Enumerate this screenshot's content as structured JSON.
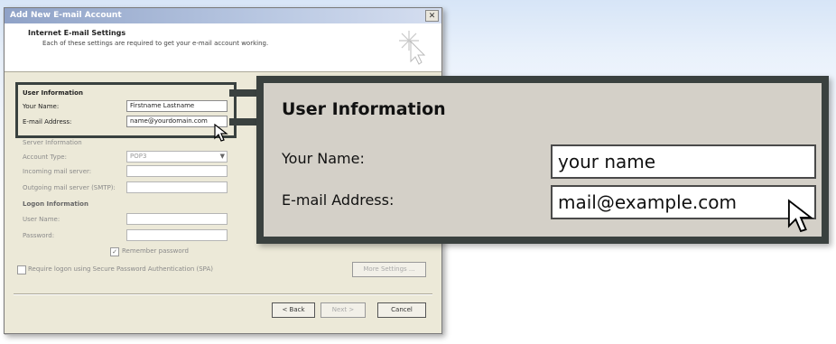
{
  "dialog": {
    "title": "Add New E-mail Account",
    "close_glyph": "✕",
    "header_title": "Internet E-mail Settings",
    "header_subtitle": "Each of these settings are required to get your e-mail account working."
  },
  "user_info": {
    "section_title": "User Information",
    "name_label": "Your Name:",
    "name_value": "Firstname Lastname",
    "email_label": "E-mail Address:",
    "email_value": "name@yourdomain.com"
  },
  "server_info": {
    "section_title": "Server Information",
    "account_type_label": "Account Type:",
    "account_type_value": "POP3",
    "incoming_label": "Incoming mail server:",
    "outgoing_label": "Outgoing mail server (SMTP):"
  },
  "logon_info": {
    "section_title": "Logon Information",
    "username_label": "User Name:",
    "password_label": "Password:",
    "remember_label": "Remember password",
    "spa_label": "Require logon using Secure Password Authentication (SPA)",
    "more_settings": "More Settings ..."
  },
  "buttons": {
    "back": "< Back",
    "next": "Next >",
    "cancel": "Cancel"
  },
  "callout": {
    "title": "User Information",
    "name_label": "Your Name:",
    "name_value": "your name",
    "email_label": "E-mail Address:",
    "email_value": "mail@example.com"
  },
  "icons": {
    "cursor": "arrow-cursor-icon",
    "header_graphic": "sparkle-cursor-icon",
    "dropdown": "chevron-down-icon",
    "checkbox": "checkbox-icon"
  }
}
